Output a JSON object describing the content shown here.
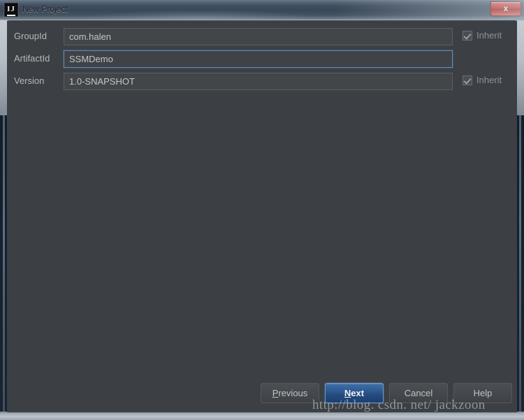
{
  "window": {
    "title": "New Project",
    "app_icon": "intellij-idea-icon",
    "close_label": "x"
  },
  "form": {
    "fields": [
      {
        "label": "GroupId",
        "value": "com.halen",
        "placeholder": "",
        "focused": false,
        "inherit": {
          "label": "Inherit",
          "checked": true,
          "visible": true
        }
      },
      {
        "label": "ArtifactId",
        "value": "SSMDemo",
        "placeholder": "",
        "focused": true,
        "inherit": {
          "label": "",
          "checked": false,
          "visible": false
        }
      },
      {
        "label": "Version",
        "value": "1.0-SNAPSHOT",
        "placeholder": "",
        "focused": false,
        "inherit": {
          "label": "Inherit",
          "checked": true,
          "visible": true
        }
      }
    ]
  },
  "buttons": {
    "previous": {
      "prefix": "",
      "mnemonic": "P",
      "suffix": "revious",
      "default": false
    },
    "next": {
      "prefix": "",
      "mnemonic": "N",
      "suffix": "ext",
      "default": true
    },
    "cancel": {
      "prefix": "",
      "mnemonic": "",
      "suffix": "Cancel",
      "default": false
    },
    "help": {
      "prefix": "",
      "mnemonic": "",
      "suffix": "Help",
      "default": false
    }
  },
  "watermark": {
    "text": "http://blog. csdn. net/ jackzoon"
  },
  "colors": {
    "dialog_background": "#3c4044",
    "field_background": "#434649",
    "field_border": "#5a5f63",
    "focus_border": "#5c89c4",
    "text_primary": "#c3c6c8",
    "label_text": "#b5b8ba",
    "muted_text": "#8d9295",
    "default_button_blue": "#2f5b92",
    "close_button_red": "#bf2018",
    "titlebar_gradient_top": "#6f7d8c",
    "titlebar_gradient_bottom": "#8b959e"
  }
}
